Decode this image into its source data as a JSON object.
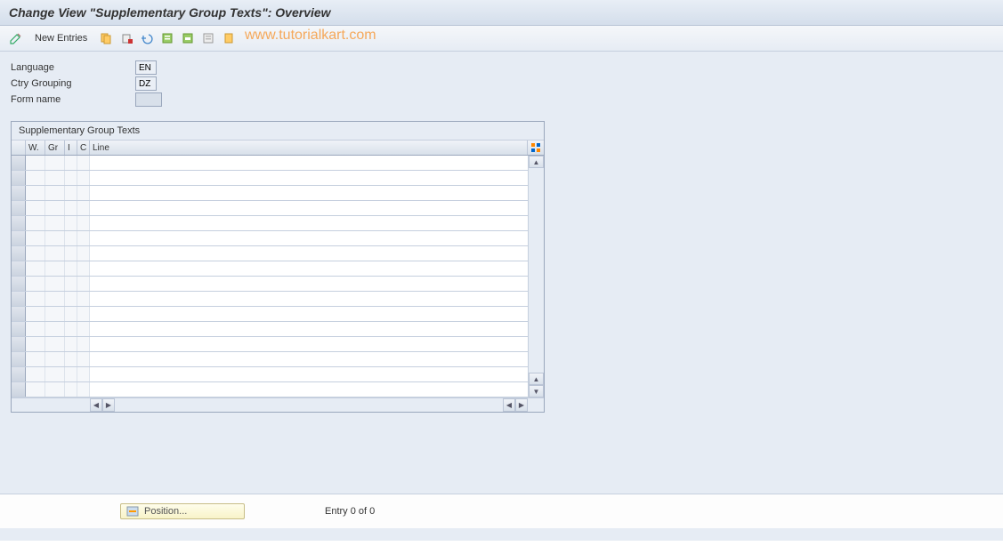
{
  "title": "Change View \"Supplementary Group Texts\": Overview",
  "toolbar": {
    "new_entries": "New Entries"
  },
  "watermark": "www.tutorialkart.com",
  "fields": {
    "language": {
      "label": "Language",
      "value": "EN"
    },
    "ctry_grouping": {
      "label": "Ctry Grouping",
      "value": "DZ"
    },
    "form_name": {
      "label": "Form name",
      "value": ""
    }
  },
  "table": {
    "title": "Supplementary Group Texts",
    "columns": {
      "w": "W.",
      "gr": "Gr",
      "i": "I",
      "c": "C",
      "line": "Line"
    },
    "row_count": 16
  },
  "footer": {
    "position_btn": "Position...",
    "entry_text": "Entry 0 of 0"
  }
}
